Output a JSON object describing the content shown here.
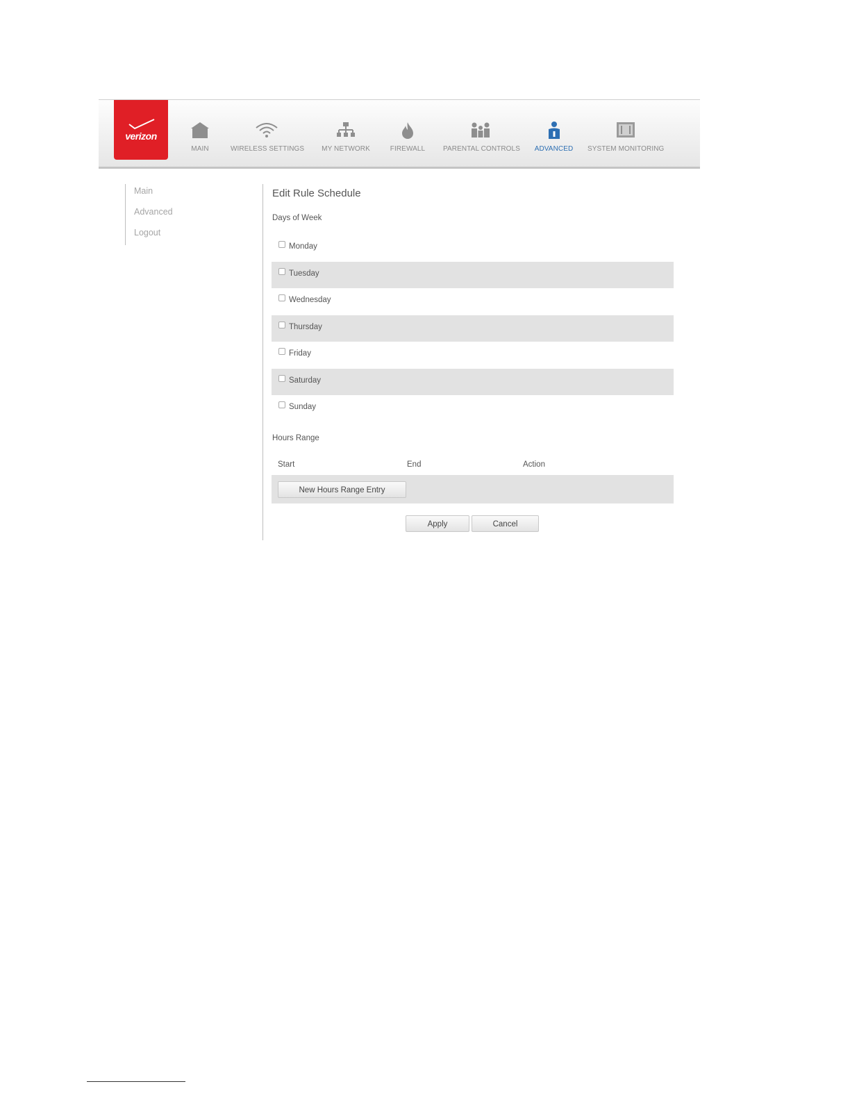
{
  "logo": {
    "text": "verizon"
  },
  "nav": {
    "items": [
      {
        "label": "MAIN",
        "icon": "home-icon"
      },
      {
        "label": "WIRELESS SETTINGS",
        "icon": "wifi-icon"
      },
      {
        "label": "MY NETWORK",
        "icon": "network-icon"
      },
      {
        "label": "FIREWALL",
        "icon": "flame-icon"
      },
      {
        "label": "PARENTAL CONTROLS",
        "icon": "family-icon"
      },
      {
        "label": "ADVANCED",
        "icon": "advanced-user-icon"
      },
      {
        "label": "SYSTEM MONITORING",
        "icon": "monitor-icon"
      }
    ],
    "active": "ADVANCED",
    "active_color": "#2d6fb3"
  },
  "leftmenu": {
    "items": [
      "Main",
      "Advanced",
      "Logout"
    ]
  },
  "page": {
    "title": "Edit Rule Schedule",
    "days_heading": "Days of Week",
    "days": [
      "Monday",
      "Tuesday",
      "Wednesday",
      "Thursday",
      "Friday",
      "Saturday",
      "Sunday"
    ],
    "hours_heading": "Hours Range",
    "columns": {
      "start": "Start",
      "end": "End",
      "action": "Action"
    },
    "new_entry_button": "New Hours Range Entry",
    "apply_button": "Apply",
    "cancel_button": "Cancel"
  },
  "colors": {
    "brand": "#e01f26",
    "row_shade": "#e2e2e2"
  }
}
